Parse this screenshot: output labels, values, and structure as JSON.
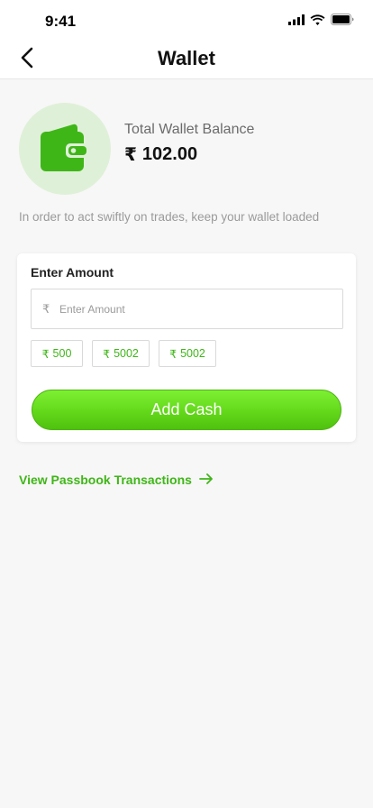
{
  "status_bar": {
    "time": "9:41",
    "icons": [
      "signal-icon",
      "wifi-icon",
      "battery-icon"
    ]
  },
  "header": {
    "title": "Wallet",
    "back_icon": "chevron-left-icon"
  },
  "balance": {
    "icon": "wallet-icon",
    "label": "Total Wallet Balance",
    "currency": "₹",
    "amount": "102.00"
  },
  "hint": "In order to act swiftly on trades, keep your wallet loaded",
  "amount_card": {
    "label": "Enter Amount",
    "currency": "₹",
    "input_value": "",
    "input_placeholder": "Enter Amount",
    "quick_amounts": [
      {
        "currency": "₹",
        "value": "500"
      },
      {
        "currency": "₹",
        "value": "5002"
      },
      {
        "currency": "₹",
        "value": "5002"
      }
    ],
    "add_cash_label": "Add Cash"
  },
  "passbook_link": {
    "label": "View Passbook Transactions",
    "icon": "arrow-right-icon"
  },
  "colors": {
    "accent": "#3fb618",
    "button_gradient_top": "#7ef033",
    "button_gradient_bottom": "#4fc10f",
    "avatar_bg": "#dff0d8",
    "page_bg": "#f7f7f7"
  }
}
